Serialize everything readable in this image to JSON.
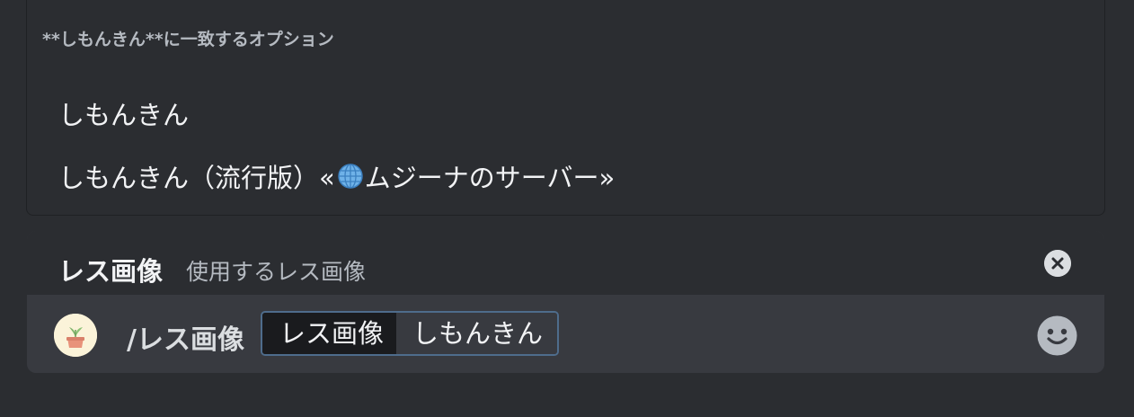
{
  "autocomplete": {
    "header": "**しもんきん**に一致するオプション",
    "options": [
      {
        "label": "しもんきん"
      },
      {
        "label_before": "しもんきん（流行版）«",
        "label_after": "ムジーナのサーバー»",
        "icon": "globe-icon"
      }
    ]
  },
  "composer": {
    "command_name": "レス画像",
    "command_description": "使用するレス画像",
    "close_icon": "close-circle-icon",
    "avatar_icon": "plant-pot-icon",
    "command_text": "/レス画像",
    "option_label": "レス画像",
    "option_value": "しもんきん",
    "emoji_icon": "smiley-face-icon"
  }
}
